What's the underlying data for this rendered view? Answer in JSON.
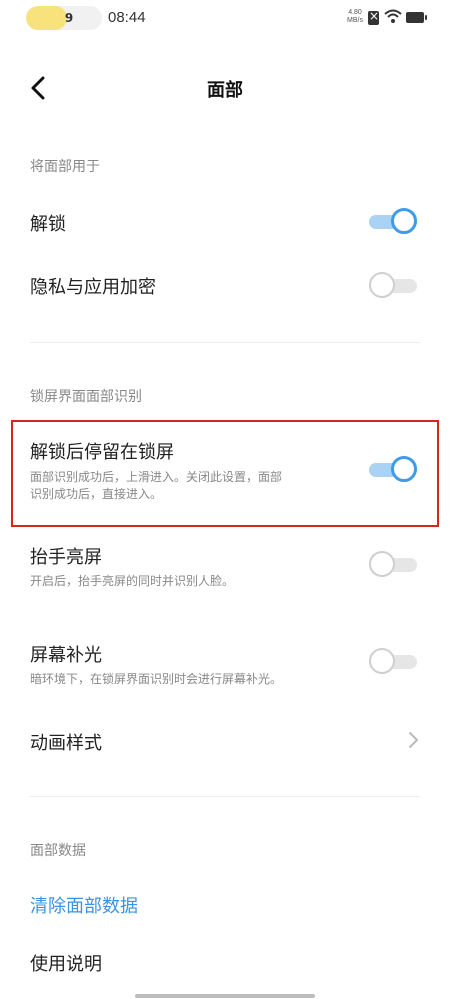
{
  "status_bar": {
    "battery_level": "9",
    "battery_fraction": 0.09,
    "time": "08:44",
    "network_speed_value": "4.80",
    "network_speed_unit": "MB/s",
    "icons": [
      "sim-missing-icon",
      "wifi-icon",
      "battery-icon"
    ]
  },
  "header": {
    "title": "面部",
    "back_icon": "chevron-left-icon"
  },
  "sections": {
    "use_face_for": {
      "label": "将面部用于",
      "unlock": {
        "title": "解锁",
        "toggle_on": true
      },
      "privacy": {
        "title": "隐私与应用加密",
        "toggle_on": false
      }
    },
    "lockscreen": {
      "label": "锁屏界面面部识别",
      "stay_on_lock": {
        "title": "解锁后停留在锁屏",
        "desc_line1": "面部识别成功后，上滑进入。关闭此设置，面部",
        "desc_line2": "识别成功后，直接进入。",
        "toggle_on": true,
        "highlight_color": "#d9261c"
      },
      "raise_to_wake": {
        "title": "抬手亮屏",
        "desc": "开启后，抬手亮屏的同时并识别人脸。",
        "toggle_on": false
      },
      "screen_fill_light": {
        "title": "屏幕补光",
        "desc": "暗环境下，在锁屏界面识别时会进行屏幕补光。",
        "toggle_on": false
      },
      "animation_style": {
        "title": "动画样式",
        "icon": "chevron-right-icon"
      }
    },
    "face_data": {
      "label": "面部数据",
      "clear": {
        "title": "清除面部数据",
        "color": "#3994e6"
      },
      "instructions": {
        "title": "使用说明"
      }
    }
  },
  "colors": {
    "toggle_on_thumb": "#3d9be9",
    "toggle_on_track": "#a9d2f4",
    "toggle_off_track": "#e6e6e6",
    "battery_pill": "#f7e27c"
  }
}
